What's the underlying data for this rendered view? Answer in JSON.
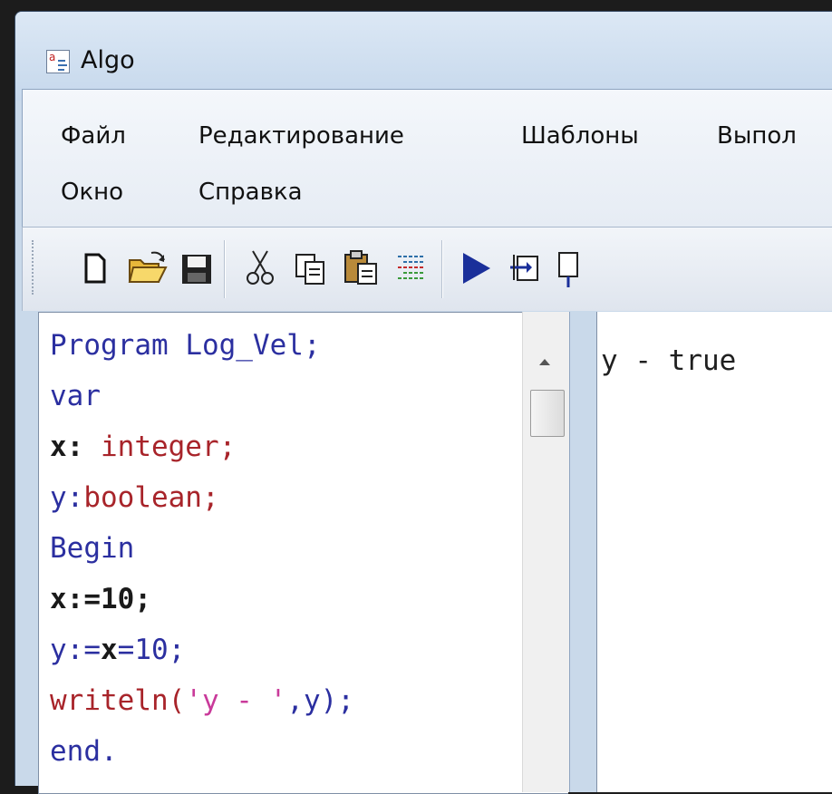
{
  "window": {
    "title": "Algo",
    "app_icon": "algo-app-icon"
  },
  "menu": {
    "items": [
      "Файл",
      "Редактирование",
      "Шаблоны",
      "Выпол",
      "Окно",
      "Справка"
    ]
  },
  "toolbar": {
    "buttons": [
      "new-file-icon",
      "open-folder-icon",
      "save-icon",
      "cut-icon",
      "copy-icon",
      "paste-icon",
      "format-icon",
      "run-icon",
      "step-into-icon",
      "step-icon"
    ]
  },
  "editor": {
    "lines": [
      {
        "parts": [
          {
            "t": "Program",
            "c": "kw"
          },
          {
            "t": " Log_Vel;",
            "c": "kw"
          }
        ]
      },
      {
        "parts": [
          {
            "t": "var",
            "c": "kw"
          }
        ]
      },
      {
        "parts": [
          {
            "t": "x:",
            "c": "bd"
          },
          {
            "t": " integer;",
            "c": "tp"
          }
        ]
      },
      {
        "parts": [
          {
            "t": "y:",
            "c": "kw"
          },
          {
            "t": "boolean;",
            "c": "tp"
          }
        ]
      },
      {
        "parts": [
          {
            "t": "Begin",
            "c": "kw"
          }
        ]
      },
      {
        "parts": [
          {
            "t": "x:=10;",
            "c": "bd"
          }
        ]
      },
      {
        "parts": [
          {
            "t": "y:=",
            "c": "kw"
          },
          {
            "t": "x",
            "c": "bd"
          },
          {
            "t": "=10;",
            "c": "kw"
          }
        ]
      },
      {
        "parts": [
          {
            "t": "writeln(",
            "c": "tp"
          },
          {
            "t": "'y - '",
            "c": "st"
          },
          {
            "t": ",y);",
            "c": "kw"
          }
        ]
      },
      {
        "parts": [
          {
            "t": "end.",
            "c": "kw"
          }
        ]
      }
    ]
  },
  "output": {
    "text": "y - true"
  },
  "colors": {
    "keyword": "#2b2fa0",
    "type": "#a8242a",
    "string": "#c93a9a",
    "chrome": "#c9d9ea"
  }
}
